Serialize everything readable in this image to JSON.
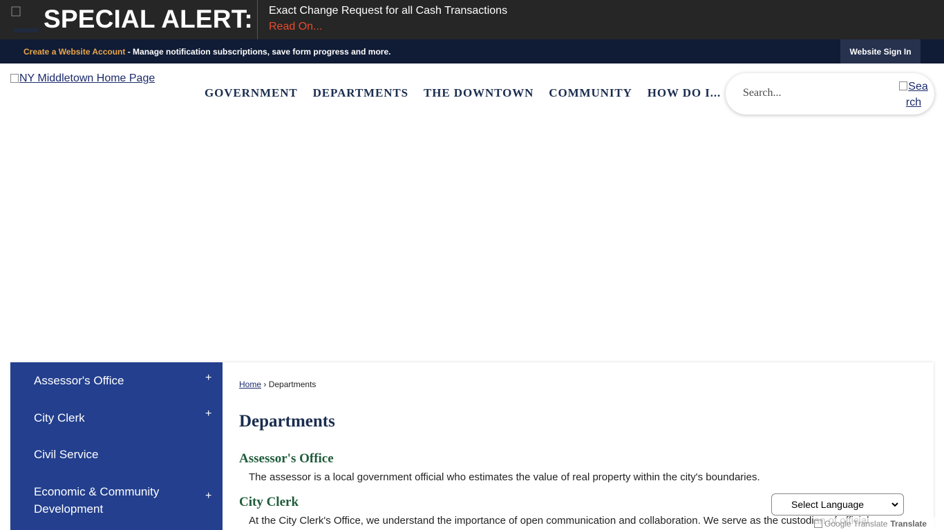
{
  "alert": {
    "title": "SPECIAL ALERT:",
    "message": "Exact Change Request for all Cash Transactions",
    "read_on": "Read On...",
    "colors": {
      "background": "#262626",
      "link": "#e84b2b"
    }
  },
  "account_bar": {
    "create_link": "Create a Website Account",
    "description": " - Manage notification subscriptions, save form progress and more.",
    "sign_in": "Website Sign In"
  },
  "header": {
    "logo_alt": "NY Middletown Home Page",
    "nav": [
      "GOVERNMENT",
      "DEPARTMENTS",
      "THE DOWNTOWN",
      "COMMUNITY",
      "HOW DO I..."
    ],
    "search_placeholder": "Search...",
    "search_button_alt_1": "Sea",
    "search_button_alt_2": "rch"
  },
  "sidebar": {
    "items": [
      {
        "label": "Assessor's Office",
        "expand": "+"
      },
      {
        "label": "City Clerk",
        "expand": "+"
      },
      {
        "label": "Civil Service",
        "expand": ""
      },
      {
        "label_1": "Economic & Community",
        "label_2": "Development",
        "expand": "+"
      }
    ]
  },
  "main": {
    "breadcrumb": {
      "home": "Home",
      "separator": "›",
      "current": "Departments"
    },
    "title": "Departments",
    "departments": [
      {
        "name": "Assessor's Office",
        "description": "The assessor is a local government official who estimates the value of real property within the city's boundaries."
      },
      {
        "name": "City Clerk",
        "description": "At the City Clerk's Office, we understand the importance of open communication and collaboration. We serve as the custodian of official"
      }
    ]
  },
  "translate": {
    "select_label": "Select Language",
    "credit_alt": "Google Translate",
    "credit_text": "Translate"
  },
  "icons": {
    "alert": "alert-image-icon",
    "search": "search-image-icon",
    "chevron": "chevron-down-icon"
  }
}
